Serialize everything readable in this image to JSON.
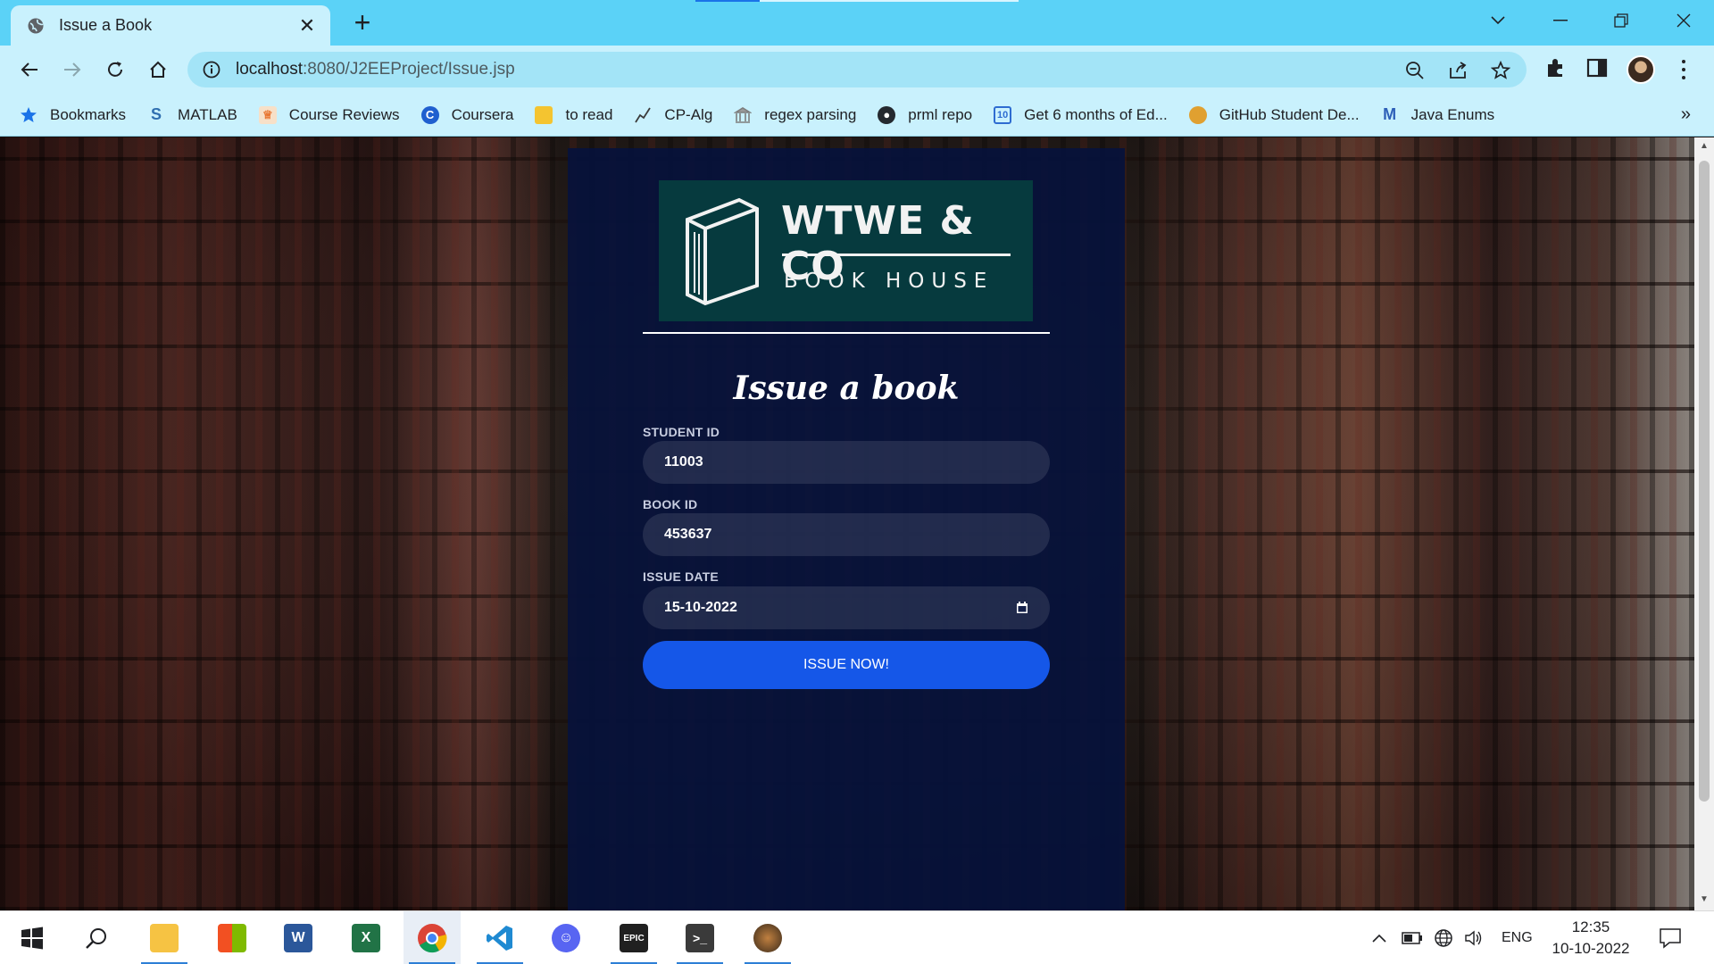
{
  "browser": {
    "tab_title": "Issue a Book",
    "url_host": "localhost",
    "url_rest": ":8080/J2EEProject/Issue.jsp"
  },
  "bookmarks": [
    {
      "label": "Bookmarks",
      "icon": "star-icon",
      "color": "#1a73e8"
    },
    {
      "label": "MATLAB",
      "icon": "matlab-icon",
      "color": "#2f6fb0"
    },
    {
      "label": "Course Reviews",
      "icon": "course-reviews-icon",
      "color": "#e8742f"
    },
    {
      "label": "Coursera",
      "icon": "coursera-icon",
      "color": "#1f5fcf"
    },
    {
      "label": "to read",
      "icon": "folder-icon",
      "color": "#f4c430"
    },
    {
      "label": "CP-Alg",
      "icon": "chart-icon",
      "color": "#3b3b3b"
    },
    {
      "label": "regex parsing",
      "icon": "building-icon",
      "color": "#7d7d7d"
    },
    {
      "label": "prml repo",
      "icon": "github-icon",
      "color": "#24292f"
    },
    {
      "label": "Get 6 months of Ed...",
      "icon": "calendar-icon",
      "color": "#2e6cd1"
    },
    {
      "label": "GitHub Student De...",
      "icon": "student-pack-icon",
      "color": "#e0a030"
    },
    {
      "label": "Java Enums",
      "icon": "gmail-icon",
      "color": "#2d5fb8"
    }
  ],
  "page": {
    "logo_brand": "WTWE & CO",
    "logo_sub": "BOOK HOUSE",
    "heading": "Issue a book",
    "student_id_label": "STUDENT ID",
    "student_id_value": "11003",
    "book_id_label": "BOOK ID",
    "book_id_value": "453637",
    "issue_date_label": "ISSUE DATE",
    "issue_date_value": "15-10-2022",
    "submit_label": "ISSUE NOW!"
  },
  "taskbar": {
    "apps": [
      "start",
      "search",
      "file-explorer",
      "microsoft-store",
      "word",
      "excel",
      "chrome",
      "vscode",
      "discord",
      "epic-games",
      "terminal",
      "game"
    ],
    "language": "ENG",
    "time": "12:35",
    "date": "10-10-2022"
  },
  "colors": {
    "tabstrip": "#5bd2f7",
    "toolbar": "#c9f1fd",
    "panel": "#06123c",
    "logo_bg": "#063a3e",
    "button": "#1557e8"
  }
}
